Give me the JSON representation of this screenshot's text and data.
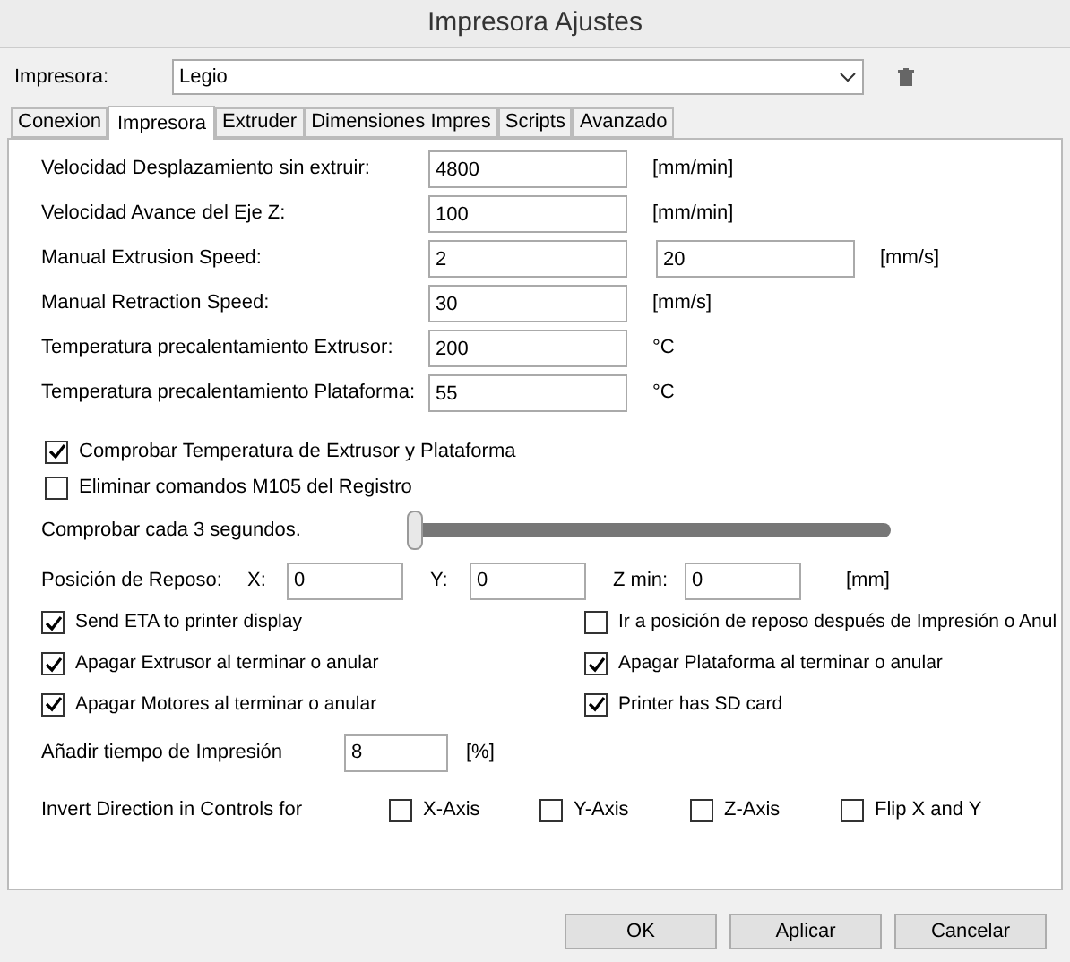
{
  "window": {
    "title": "Impresora Ajustes"
  },
  "printer": {
    "label": "Impresora:",
    "value": "Legio"
  },
  "tabs": [
    {
      "label": "Conexion",
      "selected": false
    },
    {
      "label": "Impresora",
      "selected": true
    },
    {
      "label": "Extruder",
      "selected": false
    },
    {
      "label": "Dimensiones Impres",
      "selected": false
    },
    {
      "label": "Scripts",
      "selected": false
    },
    {
      "label": "Avanzado",
      "selected": false
    }
  ],
  "fields": [
    {
      "label": "Velocidad Desplazamiento sin extruir:",
      "values": [
        "4800"
      ],
      "unit": "[mm/min]"
    },
    {
      "label": "Velocidad Avance del Eje Z:",
      "values": [
        "100"
      ],
      "unit": "[mm/min]"
    },
    {
      "label": "Manual Extrusion Speed:",
      "values": [
        "2",
        "20"
      ],
      "unit": "[mm/s]"
    },
    {
      "label": "Manual Retraction Speed:",
      "values": [
        "30"
      ],
      "unit": "[mm/s]"
    },
    {
      "label": "Temperatura precalentamiento Extrusor:",
      "values": [
        "200"
      ],
      "unit": "°C"
    },
    {
      "label": "Temperatura precalentamiento Plataforma:",
      "values": [
        "55"
      ],
      "unit": "°C"
    }
  ],
  "temp_checks": [
    {
      "label": "Comprobar Temperatura de Extrusor y Plataforma",
      "checked": true
    },
    {
      "label": "Eliminar comandos M105 del Registro",
      "checked": false
    }
  ],
  "check_interval": {
    "label": "Comprobar cada 3 segundos.",
    "level": 0
  },
  "park_position": {
    "label": "Posición de Reposo:",
    "coords": [
      {
        "label": "X:",
        "value": "0"
      },
      {
        "label": "Y:",
        "value": "0"
      },
      {
        "label": "Z min:",
        "value": "0"
      }
    ],
    "unit": "[mm]"
  },
  "options": [
    {
      "label": "Send ETA to printer display",
      "checked": true
    },
    {
      "label": "Ir a posición de reposo después de Impresión o Anul",
      "checked": false
    },
    {
      "label": "Apagar Extrusor al terminar o anular",
      "checked": true
    },
    {
      "label": "Apagar Plataforma al terminar o anular",
      "checked": true
    },
    {
      "label": "Apagar Motores al terminar o anular",
      "checked": true
    },
    {
      "label": "Printer has SD card",
      "checked": true
    }
  ],
  "print_time": {
    "label": "Añadir tiempo de Impresión",
    "value": "8",
    "unit": "[%]"
  },
  "invert": {
    "label": "Invert Direction in Controls for",
    "axes": [
      {
        "label": "X-Axis",
        "checked": false
      },
      {
        "label": "Y-Axis",
        "checked": false
      },
      {
        "label": "Z-Axis",
        "checked": false
      },
      {
        "label": "Flip X and Y",
        "checked": false
      }
    ]
  },
  "buttons": [
    "OK",
    "Aplicar",
    "Cancelar"
  ]
}
